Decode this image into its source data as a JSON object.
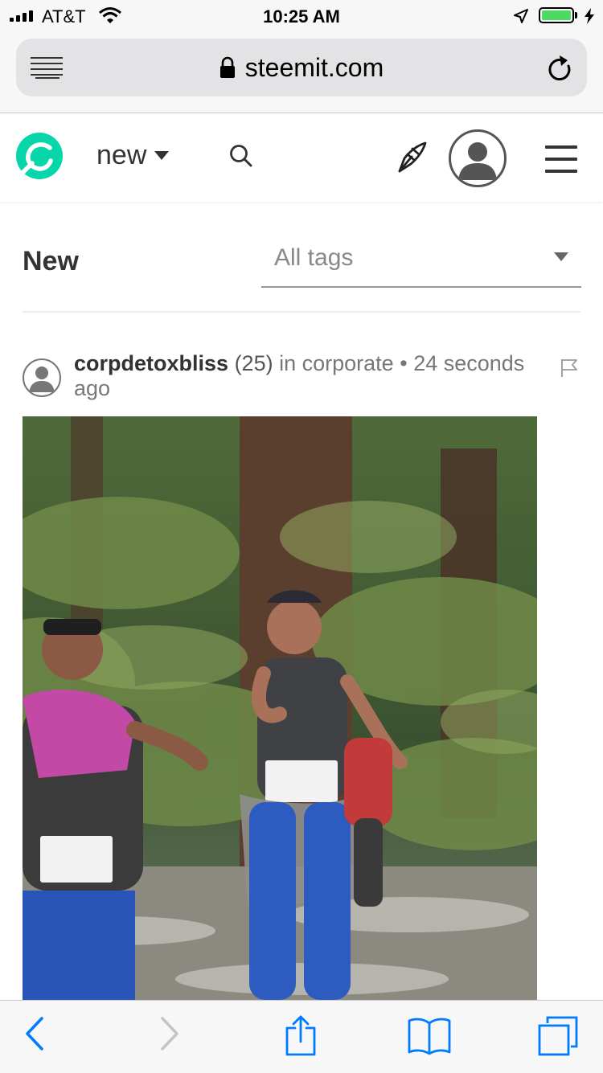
{
  "status_bar": {
    "carrier": "AT&T",
    "time": "10:25 AM",
    "battery_level": 1.0
  },
  "browser": {
    "url": "steemit.com",
    "icons": [
      "reader-icon",
      "lock-icon",
      "reload-icon"
    ],
    "toolbar_icons": [
      "back-icon",
      "forward-icon",
      "share-icon",
      "bookmarks-icon",
      "tabs-icon"
    ]
  },
  "header": {
    "sort_label": "new",
    "icons": [
      "steemit-logo-icon",
      "search-icon",
      "compose-icon",
      "user-avatar-icon",
      "menu-icon"
    ]
  },
  "page": {
    "title": "New",
    "tags_filter": "All tags"
  },
  "post": {
    "author": "corpdetoxbliss",
    "reputation": "(25)",
    "in_text": "in",
    "category": "corporate",
    "separator": "•",
    "time_ago": "24 seconds ago"
  },
  "colors": {
    "brand": "#06d6a9",
    "accent": "#007aff",
    "battery": "#4cd964"
  }
}
